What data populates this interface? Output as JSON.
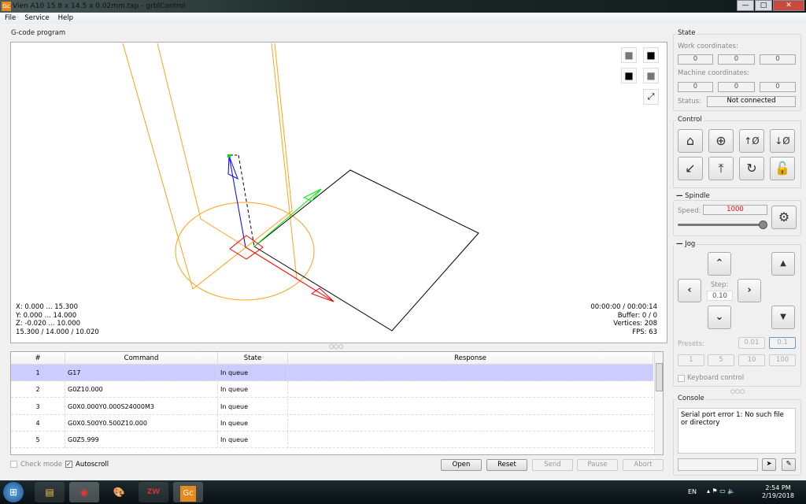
{
  "window": {
    "title": "Vien A10 15.8 x 14.5 x 0.02mm.tap - grblControl",
    "logo": "Gc",
    "minimize": "—",
    "maximize": "□",
    "close": "✕"
  },
  "menu": [
    "File",
    "Service",
    "Help"
  ],
  "program": {
    "group_label": "G-code program",
    "info_left": [
      "X: 0.000 ... 15.300",
      "Y: 0.000 ... 14.000",
      "Z: -0.020 ... 10.000",
      "15.300 / 14.000 / 10.020"
    ],
    "info_right": [
      "00:00:00 / 00:00:14",
      "Buffer: 0 / 0",
      "Vertices: 208",
      "FPS: 63"
    ],
    "view_buttons": [
      "view-top-icon",
      "view-front-icon",
      "view-left-icon",
      "view-iso-icon",
      "fit-view-icon"
    ],
    "table": {
      "headers": [
        "#",
        "Command",
        "State",
        "Response"
      ],
      "rows": [
        {
          "n": "1",
          "cmd": "G17",
          "state": "In queue",
          "resp": ""
        },
        {
          "n": "2",
          "cmd": "G0Z10.000",
          "state": "In queue",
          "resp": ""
        },
        {
          "n": "3",
          "cmd": "G0X0.000Y0.000S24000M3",
          "state": "In queue",
          "resp": ""
        },
        {
          "n": "4",
          "cmd": "G0X0.500Y0.500Z10.000",
          "state": "In queue",
          "resp": ""
        },
        {
          "n": "5",
          "cmd": "G0Z5.999",
          "state": "In queue",
          "resp": ""
        }
      ]
    },
    "check_mode": {
      "label": "Check mode",
      "checked": false
    },
    "autoscroll": {
      "label": "Autoscroll",
      "checked": true
    },
    "buttons": {
      "open": "Open",
      "reset": "Reset",
      "send": "Send",
      "pause": "Pause",
      "abort": "Abort"
    }
  },
  "state": {
    "label": "State",
    "work_label": "Work coordinates:",
    "work": [
      "0",
      "0",
      "0"
    ],
    "machine_label": "Machine coordinates:",
    "machine": [
      "0",
      "0",
      "0"
    ],
    "status_label": "Status:",
    "status": "Not connected"
  },
  "control": {
    "label": "Control",
    "buttons": [
      "home-icon",
      "zero-probe-icon",
      "zero-xy-icon",
      "zero-z-icon",
      "restore-origin-icon",
      "safe-position-icon",
      "reset-icon",
      "unlock-icon"
    ]
  },
  "spindle": {
    "label": "Spindle",
    "speed_label": "Speed:",
    "speed": "1000",
    "speed_color": "#ff0000",
    "slider_fraction": 1.0
  },
  "jog": {
    "label": "Jog",
    "step_label": "Step:",
    "step": "0.10",
    "presets_label": "Presets:",
    "presets": [
      "0.01",
      "0.1",
      "1",
      "5",
      "10",
      "100"
    ],
    "keyboard": {
      "label": "Keyboard control",
      "checked": false
    }
  },
  "console": {
    "label": "Console",
    "text": "Serial port error 1: No such file or directory",
    "input": ""
  },
  "taskbar": {
    "lang": "EN",
    "time": "2:54 PM",
    "date": "2/19/2018"
  }
}
